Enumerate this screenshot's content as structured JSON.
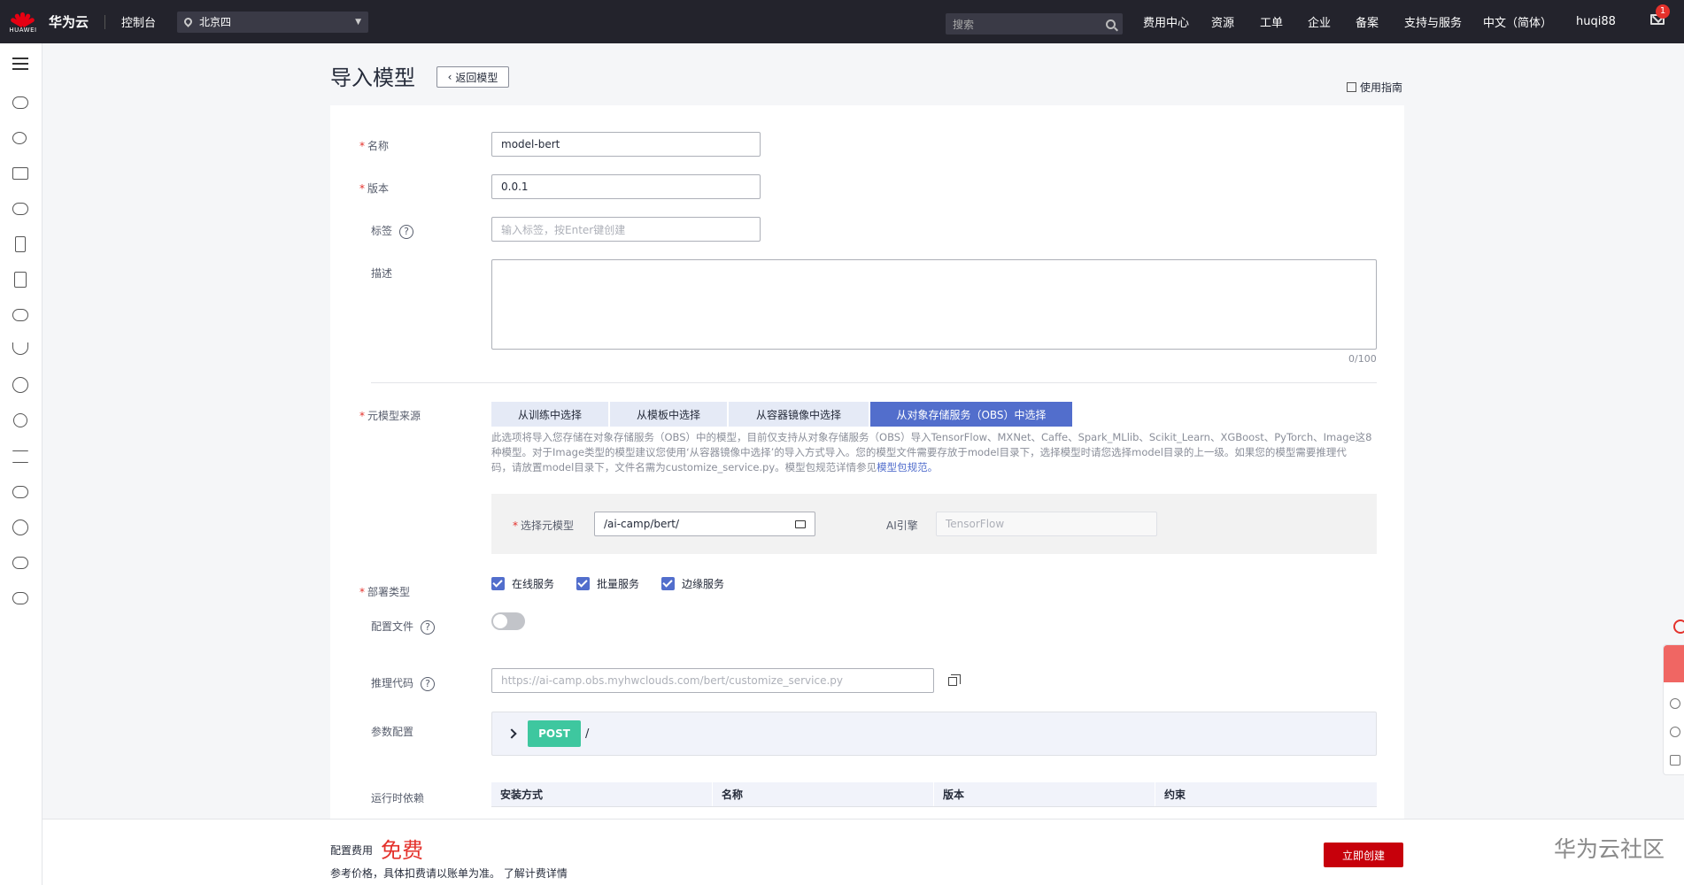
{
  "topbar": {
    "brand": "华为云",
    "logo_text": "HUAWEI",
    "console": "控制台",
    "region": "北京四",
    "search_placeholder": "搜索",
    "nav": [
      "费用中心",
      "资源",
      "工单",
      "企业",
      "备案",
      "支持与服务",
      "中文（简体）",
      "huqi88"
    ],
    "badge": "1"
  },
  "sidebar": {
    "icons": [
      "cloud-icon",
      "cluster-icon",
      "chart-icon",
      "cloud-box-icon",
      "document-icon",
      "doc-image-icon",
      "cloud-upload-icon",
      "anchor-icon",
      "globe-icon",
      "target-icon",
      "model-icon",
      "cloud-dots-icon",
      "settings-globe-icon",
      "cloud-sync-icon",
      "cloud-more-icon"
    ]
  },
  "header": {
    "title": "导入模型",
    "back_label": "返回模型",
    "guide_label": "使用指南"
  },
  "form": {
    "name_label": "名称",
    "name_value": "model-bert",
    "version_label": "版本",
    "version_value": "0.0.1",
    "tag_label": "标签",
    "tag_placeholder": "输入标签，按Enter键创建",
    "desc_label": "描述",
    "desc_counter": "0/100",
    "source_label": "元模型来源",
    "source_tabs": [
      "从训练中选择",
      "从模板中选择",
      "从容器镜像中选择",
      "从对象存储服务（OBS）中选择"
    ],
    "source_active_index": 3,
    "source_desc_1": "此选项将导入您存储在对象存储服务（OBS）中的模型，目前仅支持从对象存储服务（OBS）导入TensorFlow、MXNet、Caffe、Spark_MLlib、Scikit_Learn、XGBoost、PyTorch、Image这8",
    "source_desc_2": "种模型。对于Image类型的模型建议您使用‘从容器镜像中选择’的导入方式导入。您的模型文件需要存放于model目录下，选择模型时请您选择model目录的上一级。如果您的模型需要推理代",
    "source_desc_3": "码，请放置model目录下，文件名需为customize_service.py。模型包规范详情参见",
    "source_desc_link": "模型包规范。",
    "select_model_label": "选择元模型",
    "select_model_value": "/ai-camp/bert/",
    "ai_engine_label": "AI引擎",
    "ai_engine_value": "TensorFlow",
    "deploy_label": "部署类型",
    "deploy_options": [
      "在线服务",
      "批量服务",
      "边缘服务"
    ],
    "config_label": "配置文件",
    "infer_label": "推理代码",
    "infer_value": "https://ai-camp.obs.myhwclouds.com/bert/customize_service.py",
    "param_label": "参数配置",
    "api_method": "POST",
    "api_path": "/",
    "runtime_label": "运行时依赖",
    "runtime_columns": [
      "安装方式",
      "名称",
      "版本",
      "约束"
    ]
  },
  "footer": {
    "cost_label": "配置费用",
    "cost_value": "免费",
    "cost_note": "参考价格，具体扣费请以账单为准。 了解计费详情",
    "create_label": "立即创建",
    "watermark": "华为云社区"
  },
  "colors": {
    "topbar": "#23232c",
    "primary": "#526ecc",
    "danger": "#c7000b",
    "post": "#3ec79f"
  }
}
